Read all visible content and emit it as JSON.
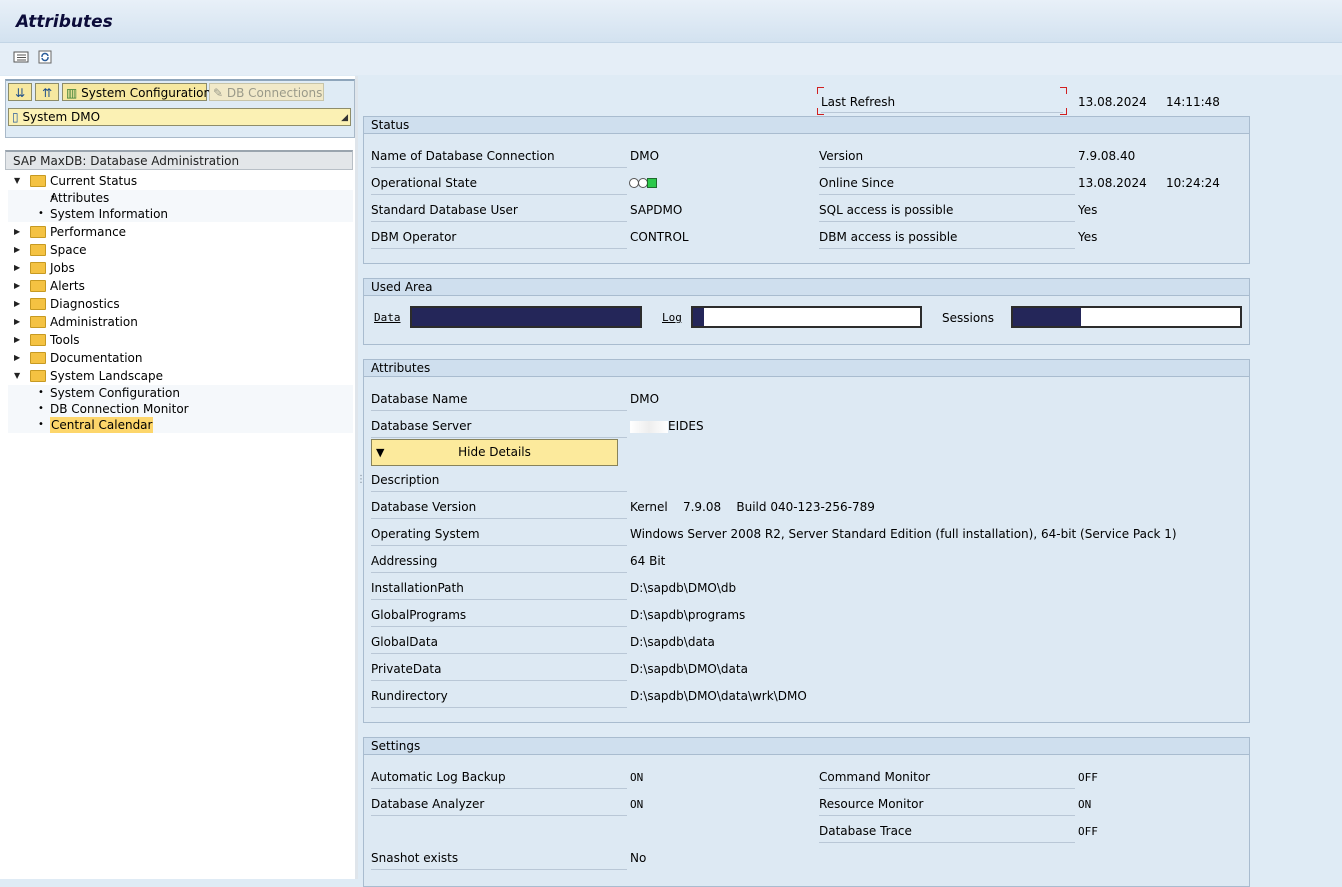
{
  "window": {
    "title": "Attributes"
  },
  "toolbar": {
    "icons": [
      "list-icon",
      "refresh-icon"
    ]
  },
  "left": {
    "buttons": {
      "expand_all_icon": "expand-all-icon",
      "collapse_all_icon": "collapse-all-icon",
      "system_config": "System Configuration",
      "db_connections": "DB Connections"
    },
    "system_select": "System DMO",
    "tree_title": "SAP MaxDB: Database Administration",
    "tree": [
      {
        "label": "Current Status",
        "type": "folder",
        "expanded": true
      },
      {
        "label": "Attributes",
        "type": "leaf"
      },
      {
        "label": "System Information",
        "type": "leaf"
      },
      {
        "label": "Performance",
        "type": "folder"
      },
      {
        "label": "Space",
        "type": "folder"
      },
      {
        "label": "Jobs",
        "type": "folder"
      },
      {
        "label": "Alerts",
        "type": "folder"
      },
      {
        "label": "Diagnostics",
        "type": "folder"
      },
      {
        "label": "Administration",
        "type": "folder"
      },
      {
        "label": "Tools",
        "type": "folder"
      },
      {
        "label": "Documentation",
        "type": "folder"
      },
      {
        "label": "System Landscape",
        "type": "folder",
        "expanded": true
      },
      {
        "label": "System Configuration",
        "type": "leaf"
      },
      {
        "label": "DB Connection Monitor",
        "type": "leaf"
      },
      {
        "label": "Central Calendar",
        "type": "leaf",
        "selected": true
      }
    ]
  },
  "refresh": {
    "label": "Last Refresh",
    "date": "13.08.2024",
    "time": "14:11:48"
  },
  "status": {
    "title": "Status",
    "name_label": "Name of Database Connection",
    "name_value": "DMO",
    "opstate_label": "Operational State",
    "opstate_value": "online",
    "user_label": "Standard Database User",
    "user_value": "SAPDMO",
    "dbm_label": "DBM Operator",
    "dbm_value": "CONTROL",
    "version_label": "Version",
    "version_value": "7.9.08.40",
    "online_label": "Online Since",
    "online_date": "13.08.2024",
    "online_time": "10:24:24",
    "sql_label": "SQL access is possible",
    "sql_value": "Yes",
    "dbm_access_label": "DBM access is possible",
    "dbm_access_value": "Yes"
  },
  "used_area": {
    "title": "Used Area",
    "data_label": "Data",
    "data_fill": 1.0,
    "log_label": "Log",
    "log_fill": 0.05,
    "sessions_label": "Sessions",
    "sessions_fill": 0.3
  },
  "attributes": {
    "title": "Attributes",
    "rows": [
      {
        "label": "Database Name",
        "value": "DMO"
      },
      {
        "label": "Database Server",
        "value": "EIDES"
      }
    ],
    "hide_details": "Hide Details",
    "details": [
      {
        "label": "Description",
        "value": ""
      },
      {
        "label": "Database Version",
        "value": "Kernel    7.9.08    Build 040-123-256-789"
      },
      {
        "label": "Operating System",
        "value": "Windows Server 2008 R2, Server Standard Edition (full installation), 64-bit (Service Pack 1)"
      },
      {
        "label": "Addressing",
        "value": "64 Bit"
      },
      {
        "label": "InstallationPath",
        "value": "D:\\sapdb\\DMO\\db"
      },
      {
        "label": "GlobalPrograms",
        "value": "D:\\sapdb\\programs"
      },
      {
        "label": "GlobalData",
        "value": "D:\\sapdb\\data"
      },
      {
        "label": "PrivateData",
        "value": "D:\\sapdb\\DMO\\data"
      },
      {
        "label": "Rundirectory",
        "value": "D:\\sapdb\\DMO\\data\\wrk\\DMO"
      }
    ]
  },
  "settings": {
    "title": "Settings",
    "auto_log_label": "Automatic Log Backup",
    "auto_log_value": "ON",
    "analyzer_label": "Database Analyzer",
    "analyzer_value": "ON",
    "snapshot_label": "Snashot exists",
    "snapshot_value": "No",
    "cmd_label": "Command Monitor",
    "cmd_value": "OFF",
    "res_label": "Resource Monitor",
    "res_value": "ON",
    "trace_label": "Database Trace",
    "trace_value": "OFF"
  }
}
